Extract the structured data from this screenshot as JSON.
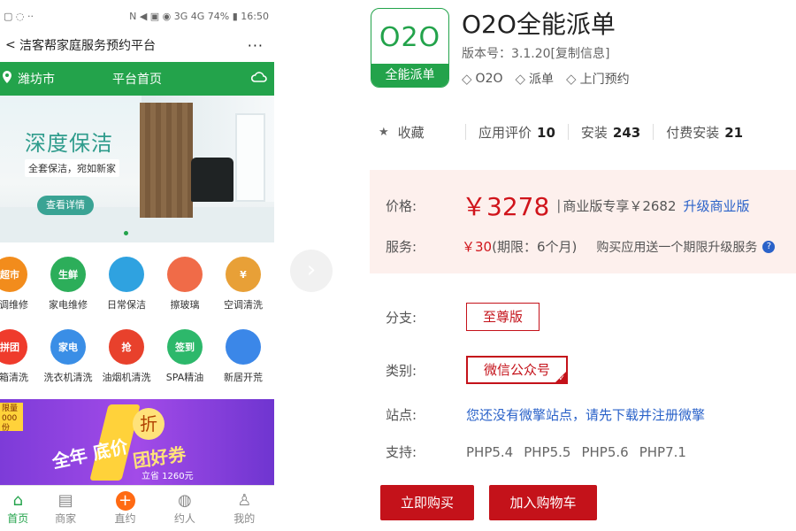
{
  "phone": {
    "status": {
      "left_icons": "▢ ◌ ··",
      "right": "N ◀ ▣ ◉ 3G 4G 74% ▮ 16:50"
    },
    "title": "洁客帮家庭服务预约平台",
    "more": "···",
    "back": "<",
    "city": "潍坊市",
    "home": "平台首页",
    "banner": {
      "headline": "深度保洁",
      "sub": "全套保洁，宛如新家",
      "button": "查看详情"
    },
    "grid": [
      [
        {
          "label": "空调维修",
          "icon_text": "超市",
          "color": "#f28c1c",
          "icon": "basket-icon"
        },
        {
          "label": "家电维修",
          "icon_text": "生鲜",
          "color": "#2cae5a",
          "icon": "fresh-icon"
        },
        {
          "label": "日常保洁",
          "icon_text": "",
          "color": "#2fa2e0",
          "icon": "cleaner-icon"
        },
        {
          "label": "擦玻璃",
          "icon_text": "",
          "color": "#f06b48",
          "icon": "bottle-icon"
        },
        {
          "label": "空调清洗",
          "icon_text": "¥",
          "color": "#e8a037",
          "icon": "money-bag-icon"
        }
      ],
      [
        {
          "label": "冰箱清洗",
          "icon_text": "拼团",
          "color": "#ef3b2c",
          "icon": "group-buy-icon"
        },
        {
          "label": "洗衣机清洗",
          "icon_text": "家电",
          "color": "#3a8ee6",
          "icon": "appliance-icon"
        },
        {
          "label": "油烟机清洗",
          "icon_text": "抢",
          "color": "#e8412c",
          "icon": "flash-sale-icon"
        },
        {
          "label": "SPA精油",
          "icon_text": "签到",
          "color": "#2db86b",
          "icon": "gift-icon"
        },
        {
          "label": "新居开荒",
          "icon_text": "",
          "color": "#3b87e8",
          "icon": "phone-icon"
        }
      ]
    ],
    "promo": {
      "tag": "限量 000份",
      "text1": "全年 底价",
      "zhe": "折",
      "quan": "团好券",
      "sub": "立省 1260元"
    },
    "tabs": [
      "首页",
      "商家",
      "直约",
      "约人",
      "我的"
    ]
  },
  "app": {
    "logo_top": "O2O",
    "logo_bottom": "全能派单",
    "name": "O2O全能派单",
    "version": "版本号：3.1.20[复制信息]",
    "tags": [
      "O2O",
      "派单",
      "上门预约"
    ],
    "stats": {
      "fav": "收藏",
      "rating_label": "应用评价",
      "rating": "10",
      "install_label": "安装",
      "install": "243",
      "paid_label": "付费安装",
      "paid": "21"
    },
    "price": {
      "label": "价格:",
      "value": "￥3278",
      "bar": "|",
      "biz": "商业版专享￥2682",
      "upgrade": "升级商业版",
      "svc_label": "服务:",
      "svc": "￥30",
      "svc_term": "(期限：6个月)",
      "gift": "购买应用送一个期限升级服务"
    },
    "branch_label": "分支:",
    "branch": "至尊版",
    "category_label": "类别:",
    "category": "微信公众号",
    "site_label": "站点:",
    "site_msg": "您还没有微擎站点，请先下载并注册微擎",
    "support_label": "支持:",
    "support": [
      "PHP5.4",
      "PHP5.5",
      "PHP5.6",
      "PHP7.1"
    ],
    "buy": "立即购买",
    "cart": "加入购物车"
  },
  "colors": {
    "green": "#23a34b",
    "red": "#c4121a",
    "link": "#2a62c9",
    "pricebg": "#fdf0ed"
  }
}
